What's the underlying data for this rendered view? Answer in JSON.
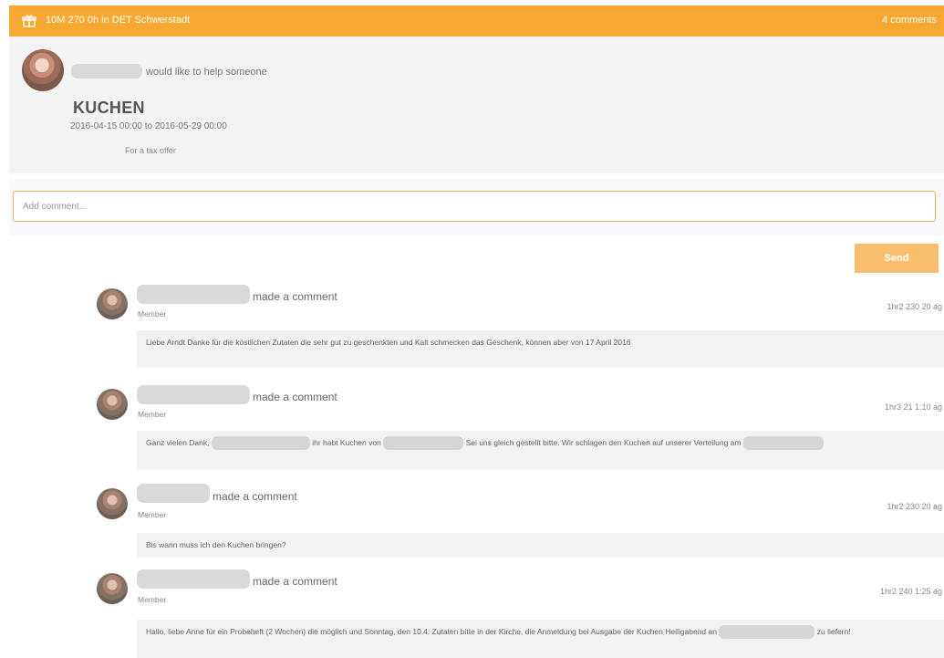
{
  "header": {
    "title": "10M 270 0h in DET Schwerstadt",
    "comment_count": "4 comments",
    "bar_color": "#f7a832"
  },
  "offer": {
    "action_text": "would like to help someone",
    "title": "KUCHEN",
    "dates": "2016-04-15 00:00 to 2016-05-29 00:00",
    "note": "For a tax offer"
  },
  "comment_input": {
    "placeholder": "Add comment..."
  },
  "send_label": "Send",
  "comments": [
    {
      "action": "made a comment",
      "role": "Member",
      "time": "1hr2 230 20 ag",
      "body": "Liebe Arndt Danke für die köstlichen Zutaten die sehr gut zu geschenkten und Kalt schmecken das Geschenk, können aber von 17 April 2016"
    },
    {
      "action": "made a comment",
      "role": "Member",
      "time": "1hr3 21 1:10 ag",
      "body_a": "Ganz vielen Dank,",
      "body_b": "ihr habt Kuchen von",
      "body_c": "Sei uns gleich gestellt bitte. Wir schlagen den Kuchen auf unserer Verteilung am"
    },
    {
      "action": "made a comment",
      "role": "Member",
      "time": "1hr2 230 20 ag",
      "body": "Bis wann muss ich den Kuchen bringen?"
    },
    {
      "action": "made a comment",
      "role": "Member",
      "time": "1hr2 240 1:25 ag",
      "body_a": "Hallo, liebe Anne für ein Probeheft (2 Wochen) die möglich und Sonntag, den 10.4. Zutaten bitte in der Kirche, die Anmeldung bei Ausgabe der Kuchen",
      "body_b": "Heiligabend an",
      "body_c": "zu liefern!"
    }
  ]
}
